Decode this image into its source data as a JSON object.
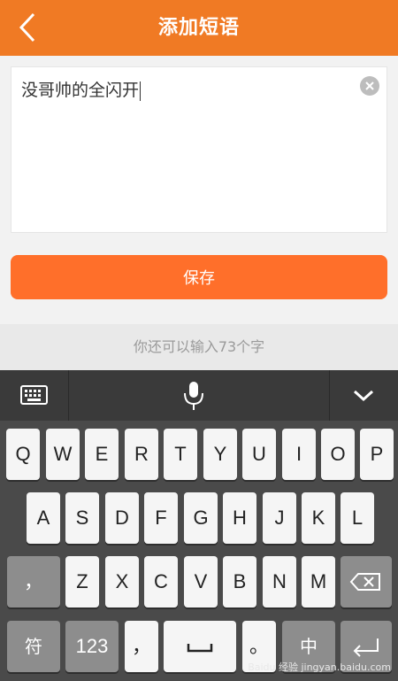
{
  "header": {
    "title": "添加短语",
    "back_icon": "chevron-left-icon"
  },
  "phrase_input": {
    "value": "没哥帅的全闪开",
    "clear_icon": "clear-x-icon"
  },
  "save_button": {
    "label": "保存"
  },
  "counter": {
    "text": "你还可以输入73个字"
  },
  "keyboard": {
    "toolbar": {
      "keyboard_icon": "keyboard-icon",
      "mic_icon": "mic-icon",
      "collapse_icon": "chevron-down-icon"
    },
    "row1": [
      "Q",
      "W",
      "E",
      "R",
      "T",
      "Y",
      "U",
      "I",
      "O",
      "P"
    ],
    "row2": [
      "A",
      "S",
      "D",
      "F",
      "G",
      "H",
      "J",
      "K",
      "L"
    ],
    "row3": {
      "comma": "，",
      "letters": [
        "Z",
        "X",
        "C",
        "V",
        "B",
        "N",
        "M"
      ],
      "backspace_icon": "backspace-icon"
    },
    "row4": {
      "symbol": "符",
      "numbers": "123",
      "comma": "，",
      "period": "。",
      "lang": "中",
      "enter_icon": "enter-icon"
    }
  },
  "watermark": {
    "text": "Baidu 经验 jingyan.baidu.com"
  }
}
